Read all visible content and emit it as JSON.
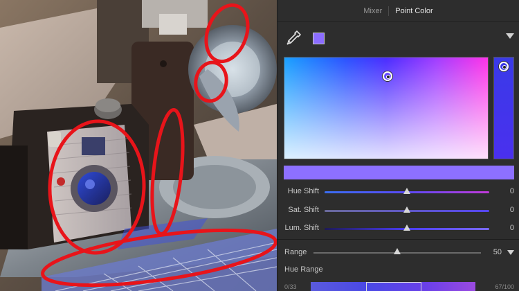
{
  "tabs": [
    {
      "label": "Mixer",
      "active": false
    },
    {
      "label": "Point Color",
      "active": true
    }
  ],
  "picker": {
    "icon": "eyedropper-icon",
    "selected_color": "#8b6cff",
    "expand_icon": "caret-down-icon"
  },
  "color_field": {
    "preview_color": "#8d70ff"
  },
  "sliders": [
    {
      "label": "Hue Shift",
      "value": "0",
      "position": 0.5
    },
    {
      "label": "Sat. Shift",
      "value": "0",
      "position": 0.5
    },
    {
      "label": "Lum. Shift",
      "value": "0",
      "position": 0.5
    }
  ],
  "range": {
    "label": "Range",
    "value": "50",
    "position": 0.5
  },
  "hue_range": {
    "title": "Hue Range",
    "left_value": "0/33",
    "right_value": "67/100"
  },
  "colors": {
    "annotation": "#e8141a",
    "panel_bg": "#2d2d2d"
  }
}
